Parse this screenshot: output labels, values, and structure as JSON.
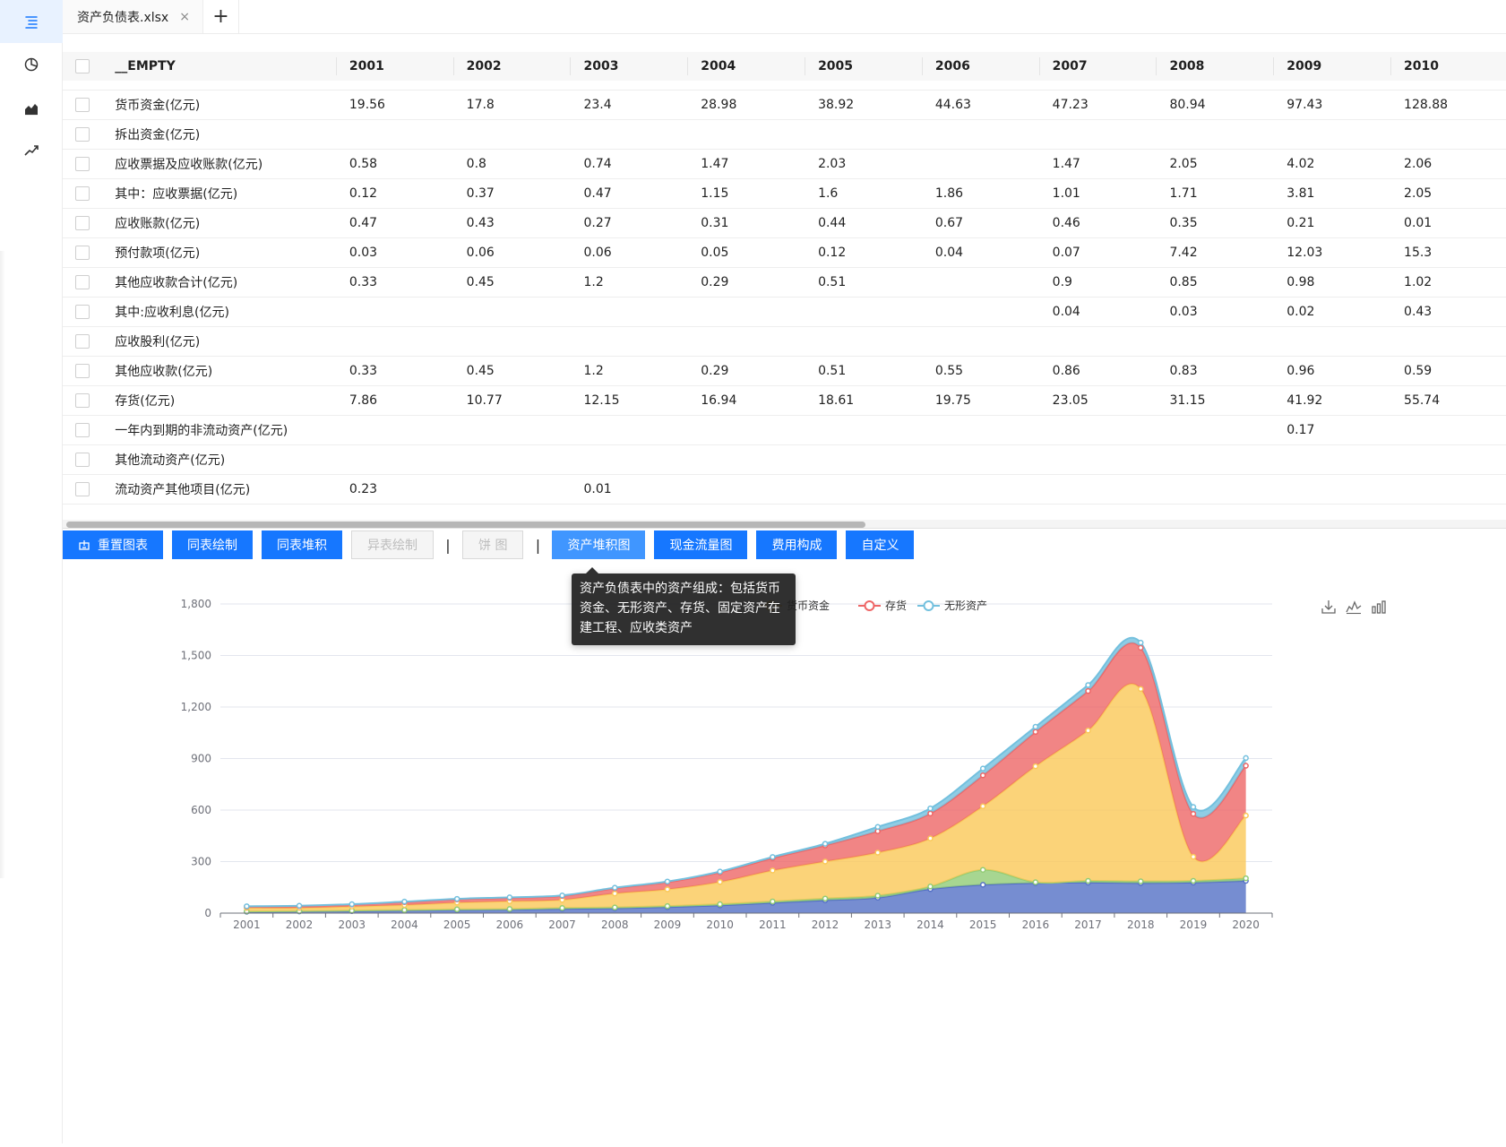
{
  "sidebar": {
    "items": [
      {
        "icon": "list-icon",
        "active": true
      },
      {
        "icon": "pie-chart-icon"
      },
      {
        "icon": "area-chart-icon"
      },
      {
        "icon": "line-chart-icon"
      }
    ]
  },
  "tabs": {
    "file_name": "资产负债表.xlsx",
    "close_glyph": "×",
    "add_glyph": "+"
  },
  "table": {
    "columns": [
      "__EMPTY",
      "2001",
      "2002",
      "2003",
      "2004",
      "2005",
      "2006",
      "2007",
      "2008",
      "2009",
      "2010"
    ],
    "rows": [
      {
        "label": "货币资金(亿元)",
        "values": [
          "19.56",
          "17.8",
          "23.4",
          "28.98",
          "38.92",
          "44.63",
          "47.23",
          "80.94",
          "97.43",
          "128.88"
        ]
      },
      {
        "label": "拆出资金(亿元)",
        "values": [
          "",
          "",
          "",
          "",
          "",
          "",
          "",
          "",
          "",
          ""
        ]
      },
      {
        "label": "应收票据及应收账款(亿元)",
        "values": [
          "0.58",
          "0.8",
          "0.74",
          "1.47",
          "2.03",
          "",
          "1.47",
          "2.05",
          "4.02",
          "2.06"
        ]
      },
      {
        "label": "其中：应收票据(亿元)",
        "values": [
          "0.12",
          "0.37",
          "0.47",
          "1.15",
          "1.6",
          "1.86",
          "1.01",
          "1.71",
          "3.81",
          "2.05"
        ]
      },
      {
        "label": "应收账款(亿元)",
        "values": [
          "0.47",
          "0.43",
          "0.27",
          "0.31",
          "0.44",
          "0.67",
          "0.46",
          "0.35",
          "0.21",
          "0.01"
        ]
      },
      {
        "label": "预付款项(亿元)",
        "values": [
          "0.03",
          "0.06",
          "0.06",
          "0.05",
          "0.12",
          "0.04",
          "0.07",
          "7.42",
          "12.03",
          "15.3"
        ]
      },
      {
        "label": "其他应收款合计(亿元)",
        "values": [
          "0.33",
          "0.45",
          "1.2",
          "0.29",
          "0.51",
          "",
          "0.9",
          "0.85",
          "0.98",
          "1.02"
        ]
      },
      {
        "label": "其中:应收利息(亿元)",
        "values": [
          "",
          "",
          "",
          "",
          "",
          "",
          "0.04",
          "0.03",
          "0.02",
          "0.43"
        ]
      },
      {
        "label": "应收股利(亿元)",
        "values": [
          "",
          "",
          "",
          "",
          "",
          "",
          "",
          "",
          "",
          ""
        ]
      },
      {
        "label": "其他应收款(亿元)",
        "values": [
          "0.33",
          "0.45",
          "1.2",
          "0.29",
          "0.51",
          "0.55",
          "0.86",
          "0.83",
          "0.96",
          "0.59"
        ]
      },
      {
        "label": "存货(亿元)",
        "values": [
          "7.86",
          "10.77",
          "12.15",
          "16.94",
          "18.61",
          "19.75",
          "23.05",
          "31.15",
          "41.92",
          "55.74"
        ]
      },
      {
        "label": "一年内到期的非流动资产(亿元)",
        "values": [
          "",
          "",
          "",
          "",
          "",
          "",
          "",
          "",
          "0.17",
          ""
        ]
      },
      {
        "label": "其他流动资产(亿元)",
        "values": [
          "",
          "",
          "",
          "",
          "",
          "",
          "",
          "",
          "",
          ""
        ]
      },
      {
        "label": "流动资产其他项目(亿元)",
        "values": [
          "0.23",
          "",
          "0.01",
          "",
          "",
          "",
          "",
          "",
          "",
          ""
        ]
      }
    ]
  },
  "toolbar": {
    "buttons": [
      {
        "label": "重置图表",
        "state": "primary",
        "icon": "reset-icon"
      },
      {
        "label": "同表绘制",
        "state": "primary"
      },
      {
        "label": "同表堆积",
        "state": "primary"
      },
      {
        "label": "异表绘制",
        "state": "disabled"
      },
      {
        "label": "饼 图",
        "state": "disabled"
      },
      {
        "label": "资产堆积图",
        "state": "highlight"
      },
      {
        "label": "现金流量图",
        "state": "primary"
      },
      {
        "label": "费用构成",
        "state": "primary"
      },
      {
        "label": "自定义",
        "state": "primary"
      }
    ],
    "separator": "|"
  },
  "tooltip": {
    "text": "资产负债表中的资产组成：包括货币资金、无形资产、存货、固定资产在建工程、应收类资产"
  },
  "colors": {
    "primary": "#1677ff",
    "series_blue": "#5470c6",
    "series_green": "#91cc75",
    "series_yellow": "#fac858",
    "series_red": "#ee6666",
    "series_cyan": "#73c0de"
  },
  "chart_data": {
    "type": "area",
    "stacked": true,
    "smooth": true,
    "x": [
      "2001",
      "2002",
      "2003",
      "2004",
      "2005",
      "2006",
      "2007",
      "2008",
      "2009",
      "2010",
      "2011",
      "2012",
      "2013",
      "2014",
      "2015",
      "2016",
      "2017",
      "2018",
      "2019",
      "2020"
    ],
    "ylim": [
      0,
      1800
    ],
    "yticks": [
      "0",
      "300",
      "600",
      "900",
      "1,200",
      "1,500",
      "1,800"
    ],
    "grid": true,
    "legend_position": "top",
    "series": [
      {
        "name": "",
        "color": "#5470c6",
        "values": [
          8,
          10,
          12,
          15,
          18,
          20,
          25,
          28,
          35,
          45,
          60,
          75,
          90,
          140,
          165,
          175,
          178,
          175,
          178,
          188
        ]
      },
      {
        "name": "",
        "color": "#91cc75",
        "values": [
          2,
          2,
          3,
          3,
          4,
          4,
          5,
          5,
          6,
          7,
          8,
          10,
          12,
          15,
          87,
          5,
          10,
          10,
          10,
          15
        ]
      },
      {
        "name": "货币资金",
        "color": "#fac858",
        "values": [
          20,
          18,
          23,
          29,
          39,
          45,
          47,
          81,
          97,
          129,
          180,
          215,
          250,
          280,
          370,
          675,
          875,
          1120,
          140,
          365
        ]
      },
      {
        "name": "存货",
        "color": "#ee6666",
        "values": [
          8,
          11,
          12,
          17,
          19,
          20,
          23,
          31,
          42,
          56,
          72,
          94,
          125,
          145,
          180,
          200,
          230,
          240,
          250,
          290
        ]
      },
      {
        "name": "无形资产",
        "color": "#73c0de",
        "values": [
          2,
          2,
          2,
          3,
          3,
          3,
          3,
          3,
          4,
          5,
          7,
          10,
          25,
          30,
          40,
          30,
          35,
          30,
          40,
          45
        ]
      }
    ]
  }
}
